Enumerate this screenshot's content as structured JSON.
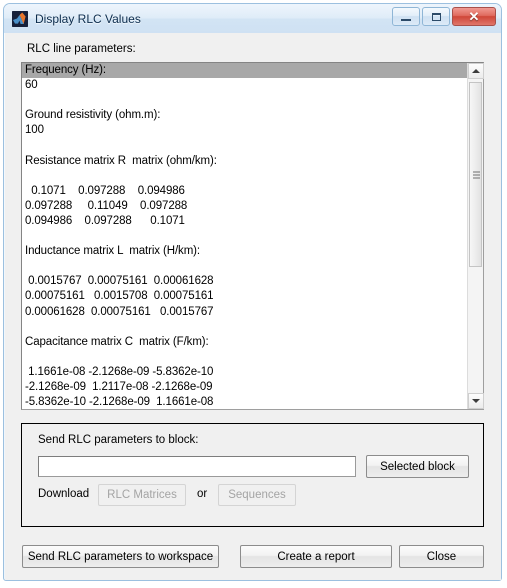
{
  "window": {
    "title": "Display RLC Values",
    "app_icon": "matlab-logo-icon",
    "controls": {
      "minimize": "minimize-icon",
      "maximize": "maximize-icon",
      "close": "✕"
    }
  },
  "main": {
    "section_label": "RLC line parameters:",
    "report": {
      "selected_line": "Frequency (Hz):",
      "body": "60\n\nGround resistivity (ohm.m):\n100\n\nResistance matrix R  matrix (ohm/km):\n\n  0.1071    0.097288    0.094986\n0.097288     0.11049    0.097288\n0.094986    0.097288      0.1071\n\nInductance matrix L  matrix (H/km):\n\n 0.0015767  0.00075161  0.00061628\n0.00075161   0.0015708  0.00075161\n0.00061628  0.00075161   0.0015767\n\nCapacitance matrix C  matrix (F/km):\n\n 1.1661e-08 -2.1268e-09 -5.8362e-10\n-2.1268e-09  1.2117e-08 -2.1268e-09\n-5.8362e-10 -2.1268e-09  1.1661e-08\n"
    },
    "scrollbar": {
      "up_arrow": "scroll-up-icon",
      "down_arrow": "scroll-down-icon"
    }
  },
  "send_panel": {
    "title": "Send RLC parameters to block:",
    "block_value": "",
    "block_placeholder": "",
    "selected_block_label": "Selected block",
    "download_label": "Download",
    "rlc_matrices_label": "RLC Matrices",
    "or_label": "or",
    "sequences_label": "Sequences"
  },
  "bottom": {
    "send_workspace_label": "Send RLC parameters to workspace",
    "create_report_label": "Create a report",
    "close_label": "Close"
  },
  "chart_data": {
    "type": "table",
    "title": "RLC line parameters",
    "parameters": [
      {
        "name": "Frequency (Hz)",
        "value": 60
      },
      {
        "name": "Ground resistivity (ohm.m)",
        "value": 100
      }
    ],
    "matrices": [
      {
        "name": "Resistance matrix R  matrix (ohm/km)",
        "unit": "ohm/km",
        "rows": [
          [
            0.1071,
            0.097288,
            0.094986
          ],
          [
            0.097288,
            0.11049,
            0.097288
          ],
          [
            0.094986,
            0.097288,
            0.1071
          ]
        ]
      },
      {
        "name": "Inductance matrix L  matrix (H/km)",
        "unit": "H/km",
        "rows": [
          [
            0.0015767,
            0.00075161,
            0.00061628
          ],
          [
            0.00075161,
            0.0015708,
            0.00075161
          ],
          [
            0.00061628,
            0.00075161,
            0.0015767
          ]
        ]
      },
      {
        "name": "Capacitance matrix C  matrix (F/km)",
        "unit": "F/km",
        "rows": [
          [
            1.1661e-08,
            -2.1268e-09,
            -5.8362e-10
          ],
          [
            -2.1268e-09,
            1.2117e-08,
            -2.1268e-09
          ],
          [
            -5.8362e-10,
            -2.1268e-09,
            1.1661e-08
          ]
        ]
      }
    ]
  }
}
